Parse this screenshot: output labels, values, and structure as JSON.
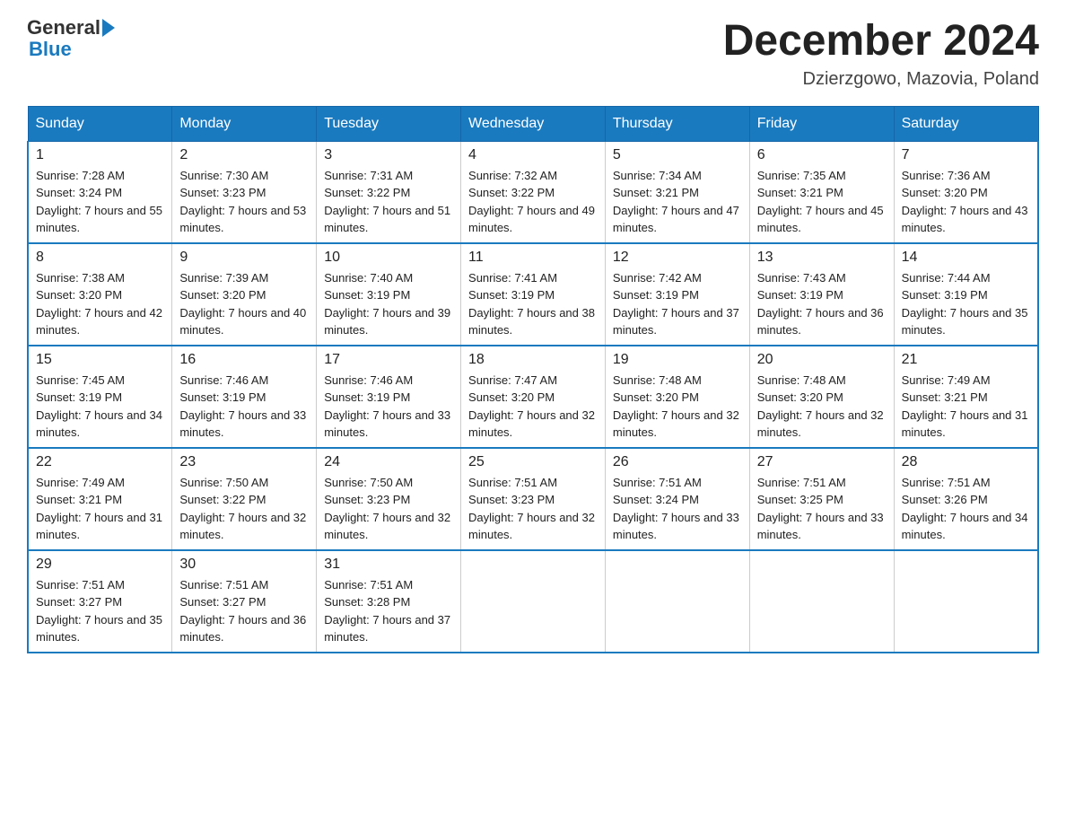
{
  "header": {
    "logo_general": "General",
    "logo_blue": "Blue",
    "month_title": "December 2024",
    "location": "Dzierzgowo, Mazovia, Poland"
  },
  "days_of_week": [
    "Sunday",
    "Monday",
    "Tuesday",
    "Wednesday",
    "Thursday",
    "Friday",
    "Saturday"
  ],
  "weeks": [
    [
      {
        "day": "1",
        "sunrise": "7:28 AM",
        "sunset": "3:24 PM",
        "daylight": "7 hours and 55 minutes."
      },
      {
        "day": "2",
        "sunrise": "7:30 AM",
        "sunset": "3:23 PM",
        "daylight": "7 hours and 53 minutes."
      },
      {
        "day": "3",
        "sunrise": "7:31 AM",
        "sunset": "3:22 PM",
        "daylight": "7 hours and 51 minutes."
      },
      {
        "day": "4",
        "sunrise": "7:32 AM",
        "sunset": "3:22 PM",
        "daylight": "7 hours and 49 minutes."
      },
      {
        "day": "5",
        "sunrise": "7:34 AM",
        "sunset": "3:21 PM",
        "daylight": "7 hours and 47 minutes."
      },
      {
        "day": "6",
        "sunrise": "7:35 AM",
        "sunset": "3:21 PM",
        "daylight": "7 hours and 45 minutes."
      },
      {
        "day": "7",
        "sunrise": "7:36 AM",
        "sunset": "3:20 PM",
        "daylight": "7 hours and 43 minutes."
      }
    ],
    [
      {
        "day": "8",
        "sunrise": "7:38 AM",
        "sunset": "3:20 PM",
        "daylight": "7 hours and 42 minutes."
      },
      {
        "day": "9",
        "sunrise": "7:39 AM",
        "sunset": "3:20 PM",
        "daylight": "7 hours and 40 minutes."
      },
      {
        "day": "10",
        "sunrise": "7:40 AM",
        "sunset": "3:19 PM",
        "daylight": "7 hours and 39 minutes."
      },
      {
        "day": "11",
        "sunrise": "7:41 AM",
        "sunset": "3:19 PM",
        "daylight": "7 hours and 38 minutes."
      },
      {
        "day": "12",
        "sunrise": "7:42 AM",
        "sunset": "3:19 PM",
        "daylight": "7 hours and 37 minutes."
      },
      {
        "day": "13",
        "sunrise": "7:43 AM",
        "sunset": "3:19 PM",
        "daylight": "7 hours and 36 minutes."
      },
      {
        "day": "14",
        "sunrise": "7:44 AM",
        "sunset": "3:19 PM",
        "daylight": "7 hours and 35 minutes."
      }
    ],
    [
      {
        "day": "15",
        "sunrise": "7:45 AM",
        "sunset": "3:19 PM",
        "daylight": "7 hours and 34 minutes."
      },
      {
        "day": "16",
        "sunrise": "7:46 AM",
        "sunset": "3:19 PM",
        "daylight": "7 hours and 33 minutes."
      },
      {
        "day": "17",
        "sunrise": "7:46 AM",
        "sunset": "3:19 PM",
        "daylight": "7 hours and 33 minutes."
      },
      {
        "day": "18",
        "sunrise": "7:47 AM",
        "sunset": "3:20 PM",
        "daylight": "7 hours and 32 minutes."
      },
      {
        "day": "19",
        "sunrise": "7:48 AM",
        "sunset": "3:20 PM",
        "daylight": "7 hours and 32 minutes."
      },
      {
        "day": "20",
        "sunrise": "7:48 AM",
        "sunset": "3:20 PM",
        "daylight": "7 hours and 32 minutes."
      },
      {
        "day": "21",
        "sunrise": "7:49 AM",
        "sunset": "3:21 PM",
        "daylight": "7 hours and 31 minutes."
      }
    ],
    [
      {
        "day": "22",
        "sunrise": "7:49 AM",
        "sunset": "3:21 PM",
        "daylight": "7 hours and 31 minutes."
      },
      {
        "day": "23",
        "sunrise": "7:50 AM",
        "sunset": "3:22 PM",
        "daylight": "7 hours and 32 minutes."
      },
      {
        "day": "24",
        "sunrise": "7:50 AM",
        "sunset": "3:23 PM",
        "daylight": "7 hours and 32 minutes."
      },
      {
        "day": "25",
        "sunrise": "7:51 AM",
        "sunset": "3:23 PM",
        "daylight": "7 hours and 32 minutes."
      },
      {
        "day": "26",
        "sunrise": "7:51 AM",
        "sunset": "3:24 PM",
        "daylight": "7 hours and 33 minutes."
      },
      {
        "day": "27",
        "sunrise": "7:51 AM",
        "sunset": "3:25 PM",
        "daylight": "7 hours and 33 minutes."
      },
      {
        "day": "28",
        "sunrise": "7:51 AM",
        "sunset": "3:26 PM",
        "daylight": "7 hours and 34 minutes."
      }
    ],
    [
      {
        "day": "29",
        "sunrise": "7:51 AM",
        "sunset": "3:27 PM",
        "daylight": "7 hours and 35 minutes."
      },
      {
        "day": "30",
        "sunrise": "7:51 AM",
        "sunset": "3:27 PM",
        "daylight": "7 hours and 36 minutes."
      },
      {
        "day": "31",
        "sunrise": "7:51 AM",
        "sunset": "3:28 PM",
        "daylight": "7 hours and 37 minutes."
      },
      null,
      null,
      null,
      null
    ]
  ]
}
